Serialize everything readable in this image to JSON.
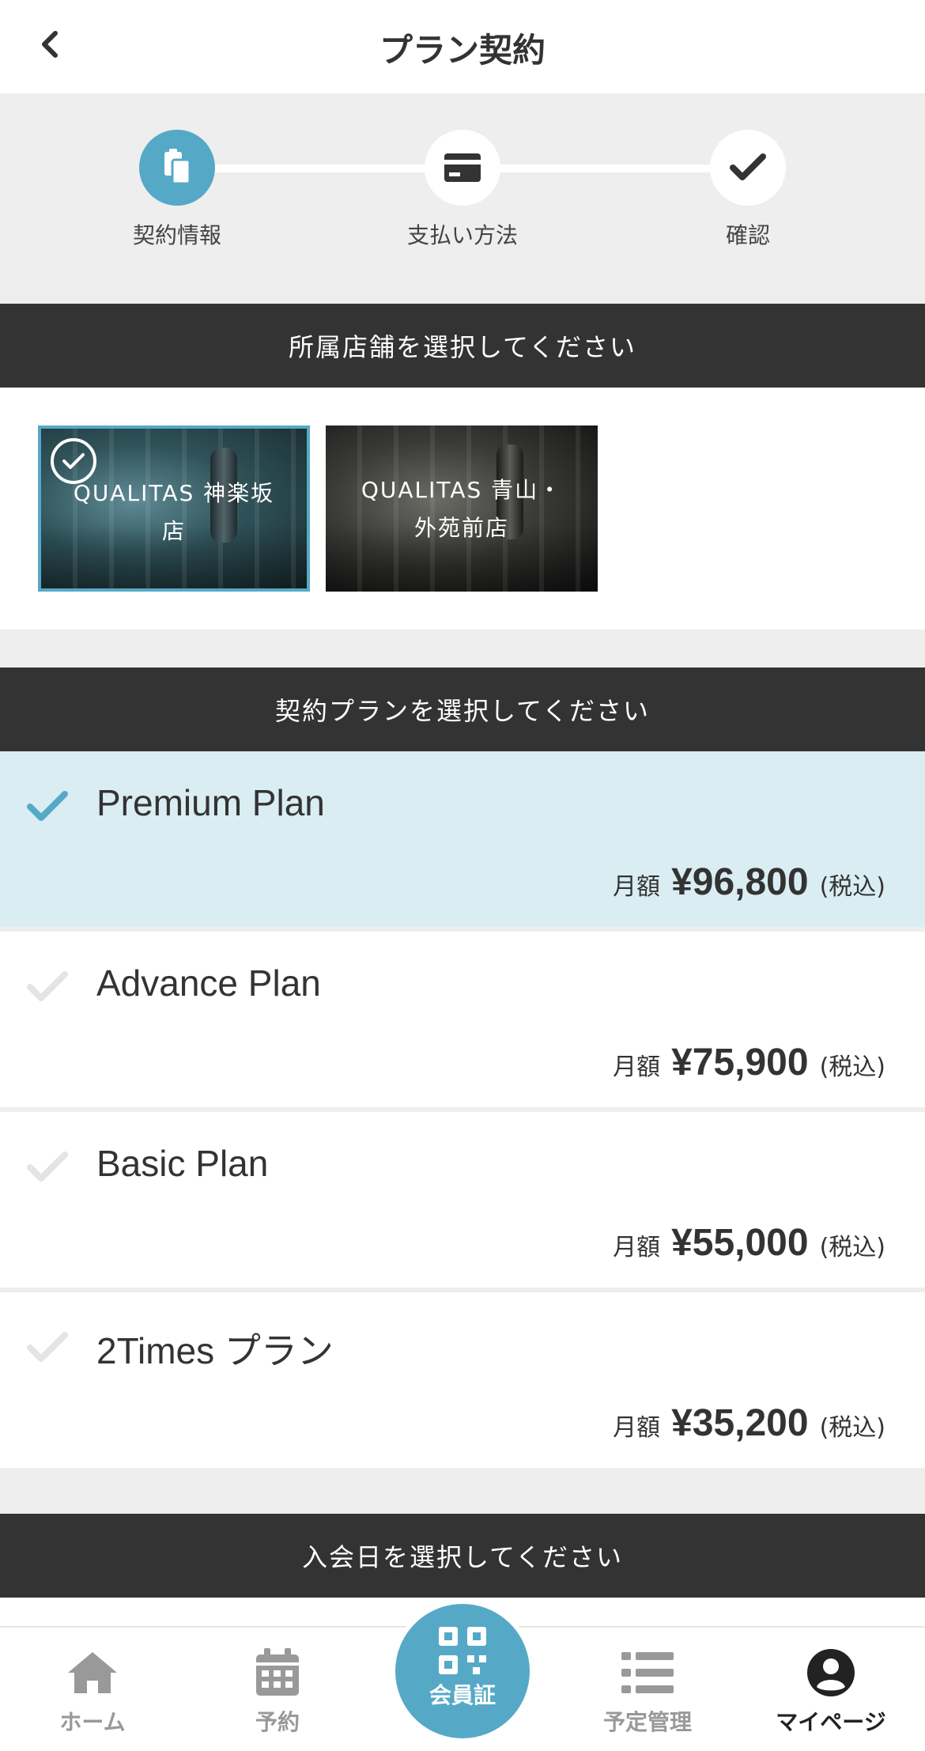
{
  "header": {
    "title": "プラン契約"
  },
  "stepper": {
    "steps": [
      {
        "label": "契約情報",
        "state": "active"
      },
      {
        "label": "支払い方法",
        "state": "pending"
      },
      {
        "label": "確認",
        "state": "pending"
      }
    ]
  },
  "store_section": {
    "title": "所属店舗を選択してください",
    "stores": [
      {
        "name": "QUALITAS 神楽坂店",
        "selected": true
      },
      {
        "name": "QUALITAS 青山・外苑前店",
        "selected": false
      }
    ]
  },
  "plan_section": {
    "title": "契約プランを選択してください",
    "price_prefix": "月額",
    "price_suffix": "(税込)",
    "plans": [
      {
        "name": "Premium Plan",
        "price": "¥96,800",
        "selected": true
      },
      {
        "name": "Advance Plan",
        "price": "¥75,900",
        "selected": false
      },
      {
        "name": "Basic Plan",
        "price": "¥55,000",
        "selected": false
      },
      {
        "name": "2Times プラン",
        "price": "¥35,200",
        "selected": false
      }
    ]
  },
  "join_date_section": {
    "title": "入会日を選択してください"
  },
  "bottom_nav": {
    "items": [
      {
        "label": "ホーム",
        "icon": "home-icon"
      },
      {
        "label": "予約",
        "icon": "calendar-icon"
      },
      {
        "label": "会員証",
        "icon": "qr-code-icon"
      },
      {
        "label": "予定管理",
        "icon": "list-icon"
      },
      {
        "label": "マイページ",
        "icon": "user-icon",
        "current": true
      }
    ]
  },
  "colors": {
    "accent": "#56a9c6",
    "dark_bar": "#333333",
    "selected_bg": "#d9edf3"
  }
}
